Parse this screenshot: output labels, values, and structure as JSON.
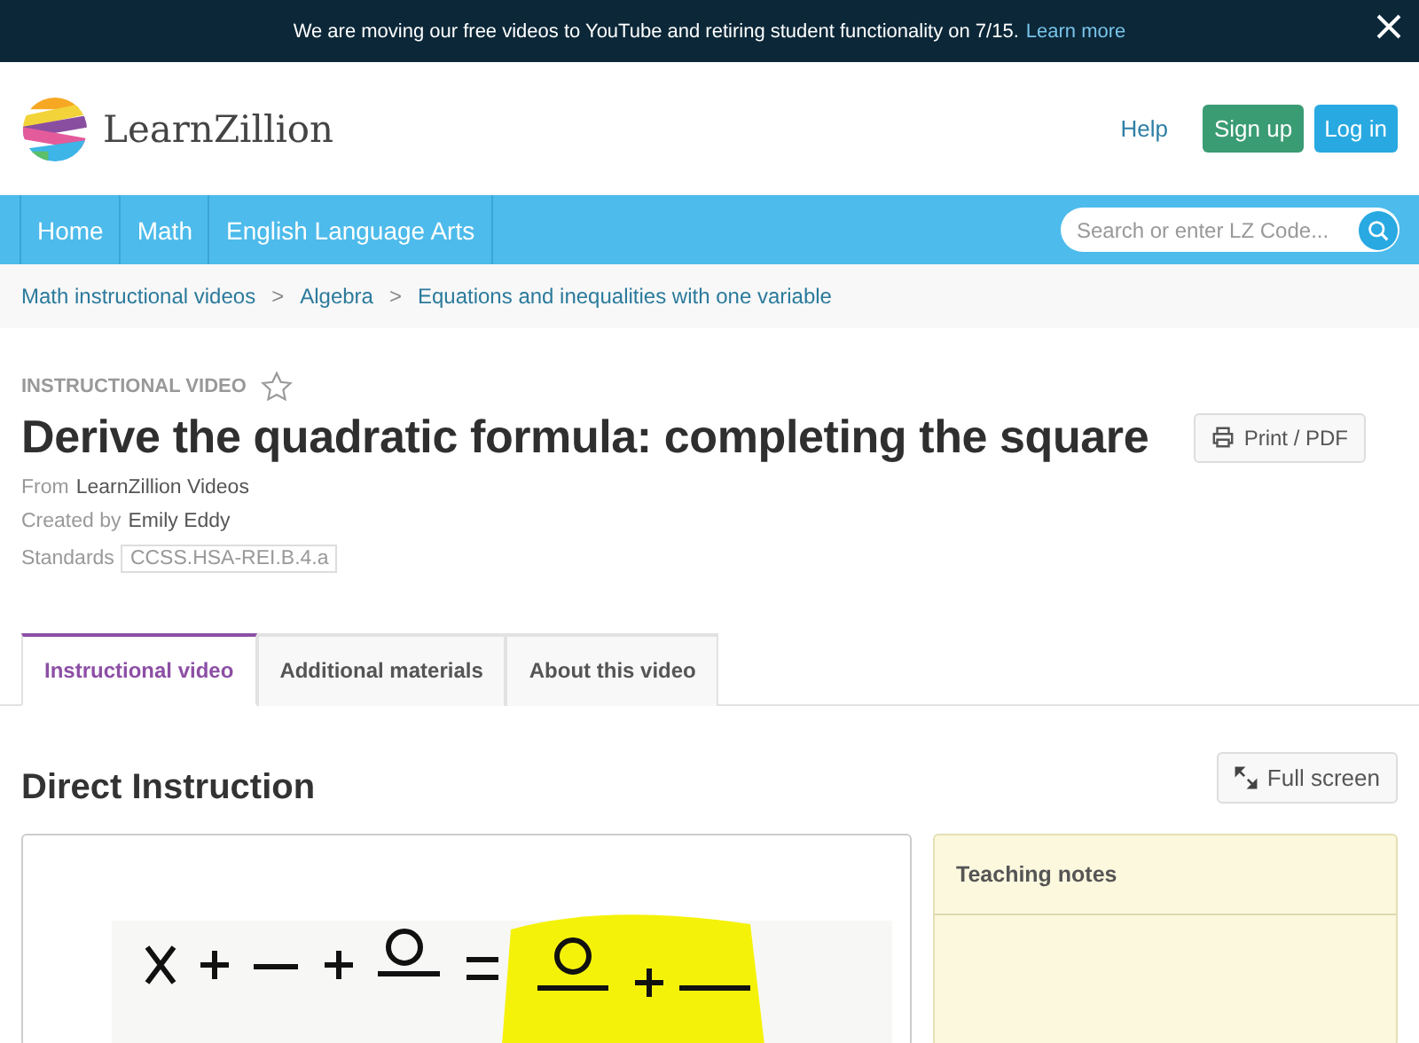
{
  "banner": {
    "message": "We are moving our free videos to YouTube and retiring student functionality on 7/15.",
    "link": "Learn more"
  },
  "header": {
    "logo": "LearnZillion",
    "links": [
      {
        "label": "Help",
        "kind": "link"
      },
      {
        "label": "Sign up",
        "kind": "green"
      },
      {
        "label": "Log in",
        "kind": "blue"
      }
    ]
  },
  "nav": {
    "items": [
      {
        "label": "Home"
      },
      {
        "label": "Math"
      },
      {
        "label": "English Language Arts"
      }
    ],
    "search": {
      "placeholder": "Search or enter LZ Code..."
    }
  },
  "breadcrumb": [
    {
      "label": "Math instructional videos"
    },
    {
      "label": "Algebra"
    },
    {
      "label": "Equations and inequalities with one variable"
    }
  ],
  "breadcrumb_separator": ">",
  "lesson": {
    "type": "INSTRUCTIONAL VIDEO",
    "favorite": false,
    "title": "Derive the quadratic formula: completing the square",
    "print_button": "Print / PDF",
    "meta": [
      {
        "label": "From",
        "value": "LearnZillion Videos",
        "kind": "text"
      },
      {
        "label": "Created by",
        "value": "Emily Eddy",
        "kind": "text"
      },
      {
        "label": "Standards",
        "value": "CCSS.HSA-REI.B.4.a",
        "kind": "tag"
      }
    ]
  },
  "tabs": [
    {
      "label": "Instructional video",
      "selected": true
    },
    {
      "label": "Additional materials",
      "selected": false
    },
    {
      "label": "About this video",
      "selected": false
    }
  ],
  "section": {
    "heading": "Direct Instruction",
    "fullscreen_button": "Full screen",
    "notes_title": "Teaching notes"
  }
}
